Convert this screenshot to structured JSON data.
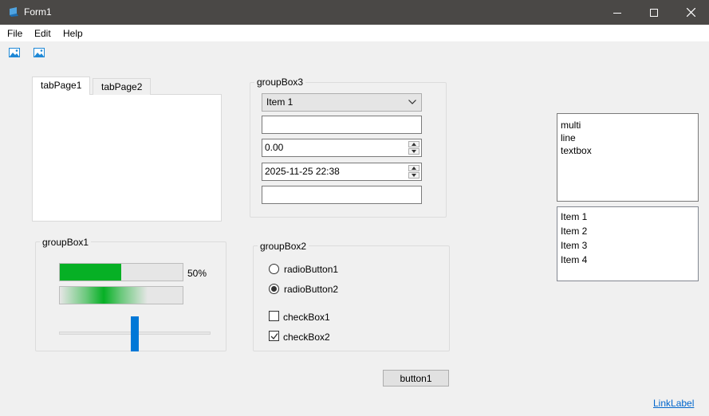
{
  "window": {
    "title": "Form1"
  },
  "menu": {
    "items": [
      "File",
      "Edit",
      "Help"
    ]
  },
  "tabs": {
    "labels": [
      "tabPage1",
      "tabPage2"
    ]
  },
  "groupBox3": {
    "title": "groupBox3",
    "combo_value": "Item 1",
    "textbox_value": "",
    "numeric_value": "0.00",
    "datetime_value": "2025-11-25 22:38",
    "textbox2_value": ""
  },
  "groupBox1": {
    "title": "groupBox1",
    "progress_label": "50%",
    "progress_fraction": 0.5,
    "trackbar_fraction": 0.5
  },
  "groupBox2": {
    "title": "groupBox2",
    "radio1_label": "radioButton1",
    "radio1_checked": false,
    "radio2_label": "radioButton2",
    "radio2_checked": true,
    "check1_label": "checkBox1",
    "check1_checked": false,
    "check2_label": "checkBox2",
    "check2_checked": true
  },
  "button1": {
    "label": "button1"
  },
  "multiline": {
    "lines": [
      "multi",
      "line",
      "textbox"
    ]
  },
  "listbox": {
    "items": [
      "Item 1",
      "Item 2",
      "Item 3",
      "Item 4"
    ]
  },
  "linklabel": {
    "text": "LinkLabel"
  },
  "colors": {
    "titlebar": "#4a4846",
    "progress": "#06b025",
    "trackbar": "#0078d7",
    "link": "#0066cc"
  },
  "icons": {
    "app": "form-app-icon",
    "toolbar": [
      "image-icon",
      "image-icon"
    ],
    "window": [
      "minimize-icon",
      "maximize-icon",
      "close-icon"
    ]
  }
}
